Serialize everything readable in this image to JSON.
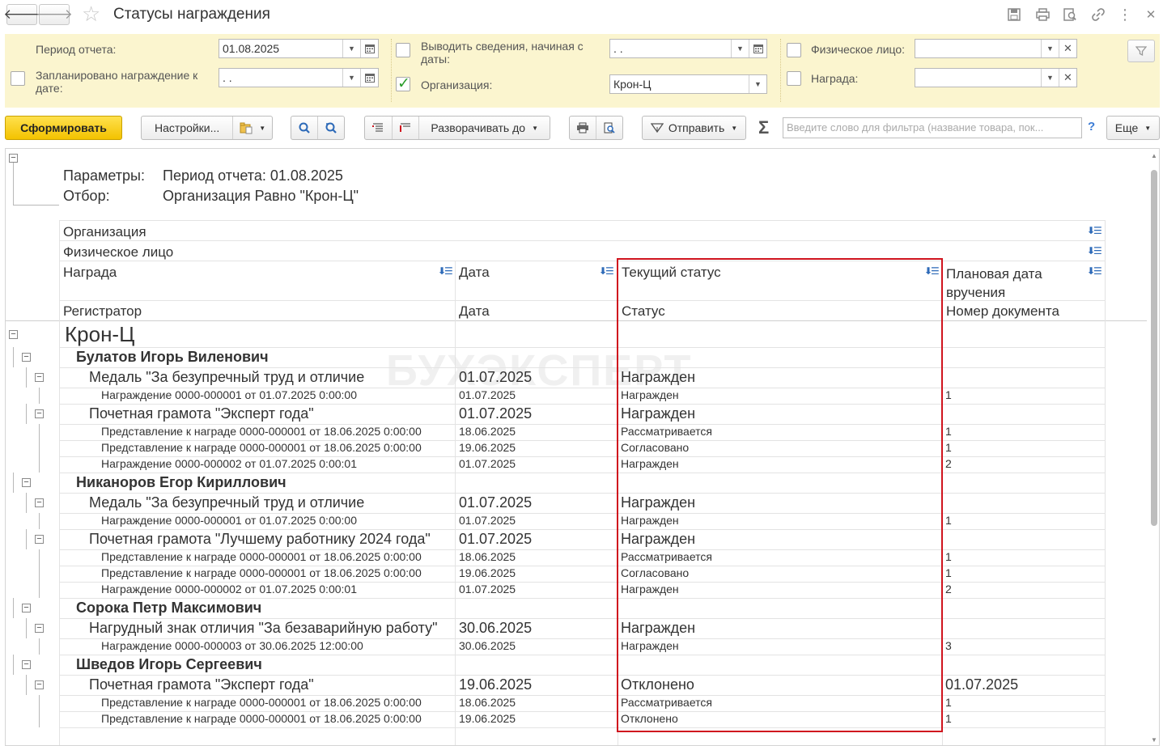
{
  "window": {
    "title": "Статусы награждения"
  },
  "filters": {
    "period_label": "Период отчета:",
    "period_value": "01.08.2025",
    "planned_label": "Запланировано награждение к дате:",
    "planned_value": " .  .",
    "show_from_label": "Выводить сведения, начиная с даты:",
    "show_from_value": " .  .",
    "org_label": "Организация:",
    "org_value": "Крон-Ц",
    "person_label": "Физическое лицо:",
    "person_value": "",
    "award_label": "Награда:",
    "award_value": ""
  },
  "toolbar": {
    "generate": "Сформировать",
    "settings": "Настройки...",
    "expand": "Разворачивать до",
    "send": "Отправить",
    "search_placeholder": "Введите слово для фильтра (название товара, пок...",
    "help": "?",
    "more": "Еще"
  },
  "report": {
    "params_label": "Параметры:",
    "params_value": "Период отчета: 01.08.2025",
    "filter_label": "Отбор:",
    "filter_value": "Организация Равно \"Крон-Ц\"",
    "headers": {
      "org": "Организация",
      "person": "Физическое лицо",
      "award": "Награда",
      "date": "Дата",
      "status": "Текущий статус",
      "plan_date": "Плановая дата вручения",
      "registrar": "Регистратор",
      "date2": "Дата",
      "status2": "Статус",
      "doc_num": "Номер документа"
    },
    "watermark": "БУХЭКСПЕРТ",
    "rows": [
      {
        "level": 0,
        "text": "Крон-Ц",
        "date": "",
        "status": "",
        "num": ""
      },
      {
        "level": 1,
        "text": "Булатов Игорь Виленович",
        "date": "",
        "status": "",
        "num": ""
      },
      {
        "level": 2,
        "text": "Медаль \"За безупречный труд и отличие",
        "date": "01.07.2025",
        "status": "Награжден",
        "num": ""
      },
      {
        "level": 3,
        "text": "Награждение 0000-000001 от 01.07.2025 0:00:00",
        "date": "01.07.2025",
        "status": "Награжден",
        "num": "1"
      },
      {
        "level": 2,
        "text": "Почетная грамота \"Эксперт года\"",
        "date": "01.07.2025",
        "status": "Награжден",
        "num": ""
      },
      {
        "level": 3,
        "text": "Представление к награде 0000-000001 от 18.06.2025 0:00:00",
        "date": "18.06.2025",
        "status": "Рассматривается",
        "num": "1"
      },
      {
        "level": 3,
        "text": "Представление к награде 0000-000001 от 18.06.2025 0:00:00",
        "date": "19.06.2025",
        "status": "Согласовано",
        "num": "1"
      },
      {
        "level": 3,
        "text": "Награждение 0000-000002 от 01.07.2025 0:00:01",
        "date": "01.07.2025",
        "status": "Награжден",
        "num": "2"
      },
      {
        "level": 1,
        "text": "Никаноров Егор Кириллович",
        "date": "",
        "status": "",
        "num": ""
      },
      {
        "level": 2,
        "text": "Медаль \"За безупречный труд и отличие",
        "date": "01.07.2025",
        "status": "Награжден",
        "num": ""
      },
      {
        "level": 3,
        "text": "Награждение 0000-000001 от 01.07.2025 0:00:00",
        "date": "01.07.2025",
        "status": "Награжден",
        "num": "1"
      },
      {
        "level": 2,
        "text": "Почетная грамота \"Лучшему работнику 2024 года\"",
        "date": "01.07.2025",
        "status": "Награжден",
        "num": ""
      },
      {
        "level": 3,
        "text": "Представление к награде 0000-000001 от 18.06.2025 0:00:00",
        "date": "18.06.2025",
        "status": "Рассматривается",
        "num": "1"
      },
      {
        "level": 3,
        "text": "Представление к награде 0000-000001 от 18.06.2025 0:00:00",
        "date": "19.06.2025",
        "status": "Согласовано",
        "num": "1"
      },
      {
        "level": 3,
        "text": "Награждение 0000-000002 от 01.07.2025 0:00:01",
        "date": "01.07.2025",
        "status": "Награжден",
        "num": "2"
      },
      {
        "level": 1,
        "text": "Сорока Петр Максимович",
        "date": "",
        "status": "",
        "num": ""
      },
      {
        "level": 2,
        "text": "Нагрудный знак отличия \"За безаварийную работу\"",
        "date": "30.06.2025",
        "status": "Награжден",
        "num": ""
      },
      {
        "level": 3,
        "text": "Награждение 0000-000003 от 30.06.2025 12:00:00",
        "date": "30.06.2025",
        "status": "Награжден",
        "num": "3"
      },
      {
        "level": 1,
        "text": "Шведов Игорь Сергеевич",
        "date": "",
        "status": "",
        "num": ""
      },
      {
        "level": 2,
        "text": "Почетная грамота \"Эксперт года\"",
        "date": "19.06.2025",
        "status": "Отклонено",
        "num": "01.07.2025"
      },
      {
        "level": 3,
        "text": "Представление к награде 0000-000001 от 18.06.2025 0:00:00",
        "date": "18.06.2025",
        "status": "Рассматривается",
        "num": "1"
      },
      {
        "level": 3,
        "text": "Представление к награде 0000-000001 от 18.06.2025 0:00:00",
        "date": "19.06.2025",
        "status": "Отклонено",
        "num": "1"
      }
    ]
  }
}
